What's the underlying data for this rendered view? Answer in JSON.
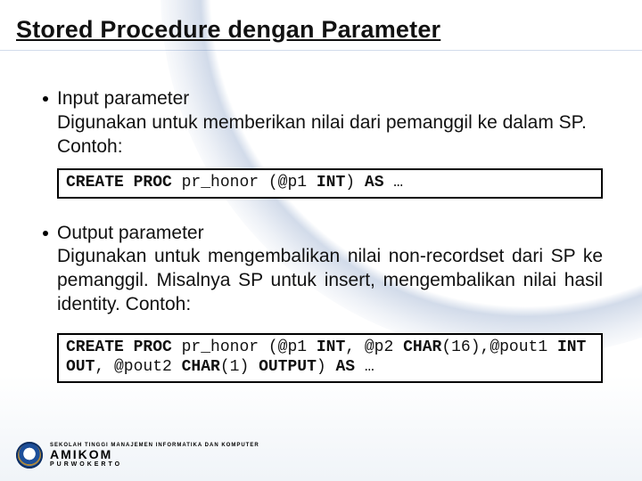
{
  "title": "Stored Procedure dengan Parameter",
  "section1": {
    "heading": "Input parameter",
    "desc": "Digunakan untuk memberikan nilai dari pemanggil ke dalam SP. Contoh:",
    "code_kw1": "CREATE PROC",
    "code_ident": " pr_honor ",
    "code_paren_open": "(@p1 ",
    "code_type": "INT",
    "code_close": ") ",
    "code_as": "AS",
    "code_tail": " …"
  },
  "section2": {
    "heading": "Output parameter",
    "desc": "Digunakan untuk mengembalikan nilai non-recordset dari SP ke pemanggil. Misalnya SP untuk insert, mengembalikan nilai hasil identity. Contoh:",
    "code_kw1": "CREATE PROC",
    "code_ident": " pr_honor ",
    "code_p1": "(@p1 ",
    "code_t1": "INT",
    "code_c1": ", @p2 ",
    "code_t2": "CHAR",
    "code_sz2": "(16),@pout1 ",
    "code_t3": "INT OUT",
    "code_c3": ", @pout2 ",
    "code_t4": "CHAR",
    "code_sz4": "(1) ",
    "code_t5": "OUTPUT",
    "code_close": ") ",
    "code_as": "AS",
    "code_tail": " …"
  },
  "footer": {
    "line1": "SEKOLAH TINGGI MANAJEMEN INFORMATIKA DAN KOMPUTER",
    "line2": "AMIKOM",
    "line3": "PURWOKERTO"
  }
}
